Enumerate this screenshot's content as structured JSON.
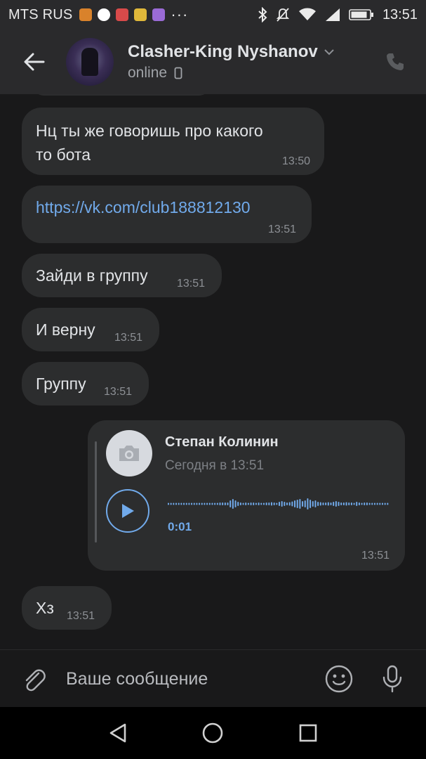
{
  "status_bar": {
    "carrier": "MTS RUS",
    "time": "13:51",
    "icons": [
      "vpn-app-icon",
      "google-icon",
      "app-icon-red",
      "app-icon-yellow",
      "app-icon-purple",
      "more-dots-icon",
      "bluetooth-icon",
      "silent-icon",
      "wifi-icon",
      "signal-icon",
      "battery-icon"
    ]
  },
  "header": {
    "name": "Clasher-King Nyshanov",
    "status": "online",
    "icons": [
      "back-arrow-icon",
      "chevron-down-icon",
      "phone-device-icon",
      "phone-call-icon"
    ]
  },
  "messages": [
    {
      "text": "Нц ты же говоришь про какого\nто бота",
      "time": "13:50"
    },
    {
      "text": "https://vk.com/club188812130",
      "time": "13:51",
      "is_link": true
    },
    {
      "text": "Зайди в группу",
      "time": "13:51"
    },
    {
      "text": "И верну",
      "time": "13:51"
    },
    {
      "text": "Группу",
      "time": "13:51"
    },
    {
      "text": "Хз",
      "time": "13:51"
    }
  ],
  "voice_message": {
    "sender": "Степан Колинин",
    "sent": "Сегодня в 13:51",
    "duration": "0:01",
    "time": "13:51",
    "icons": [
      "camera-icon",
      "play-icon"
    ]
  },
  "composer": {
    "placeholder": "Ваше сообщение",
    "icons": [
      "paperclip-icon",
      "emoji-icon",
      "microphone-icon"
    ]
  },
  "navigation": {
    "icons": [
      "back-triangle-icon",
      "home-circle-icon",
      "recents-square-icon"
    ]
  },
  "colors": {
    "background": "#19191a",
    "bar": "#2a2a2c",
    "bubble": "#2c2d2e",
    "accent": "#71aaeb",
    "text": "#e1e3e6",
    "muted": "#8d9095"
  }
}
